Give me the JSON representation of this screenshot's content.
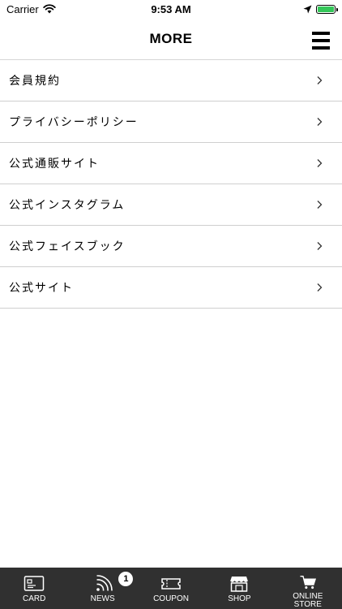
{
  "status_bar": {
    "carrier": "Carrier",
    "time": "9:53 AM",
    "battery_color": "#34c759"
  },
  "header": {
    "title": "MORE"
  },
  "menu": {
    "items": [
      {
        "label": "会員規約"
      },
      {
        "label": "プライバシーポリシー"
      },
      {
        "label": "公式通販サイト"
      },
      {
        "label": "公式インスタグラム"
      },
      {
        "label": "公式フェイスブック"
      },
      {
        "label": "公式サイト"
      }
    ]
  },
  "tabs": {
    "background": "#303030",
    "items": [
      {
        "label": "CARD",
        "icon": "card-icon"
      },
      {
        "label": "NEWS",
        "icon": "rss-icon",
        "badge": "1"
      },
      {
        "label": "COUPON",
        "icon": "ticket-icon"
      },
      {
        "label": "SHOP",
        "icon": "store-icon"
      },
      {
        "label": "ONLINE\nSTORE",
        "icon": "cart-icon"
      }
    ]
  }
}
